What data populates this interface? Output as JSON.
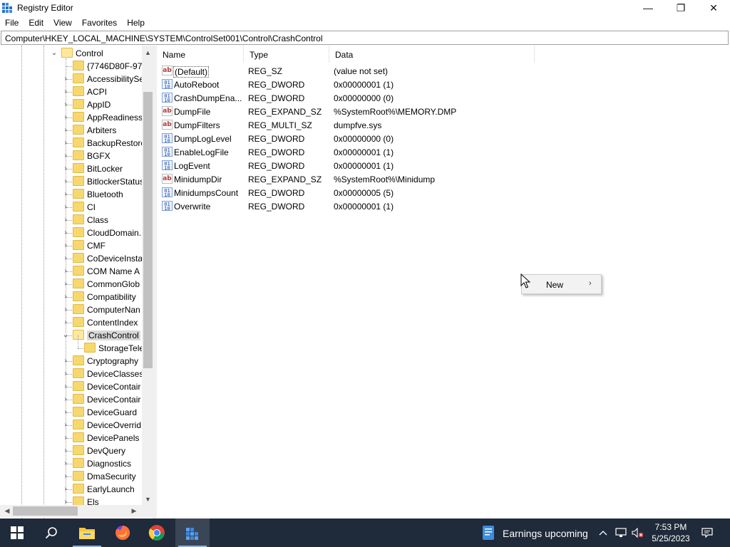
{
  "window": {
    "title": "Registry Editor",
    "minimize_glyph": "—",
    "maximize_glyph": "❐",
    "close_glyph": "✕"
  },
  "menu": [
    "File",
    "Edit",
    "View",
    "Favorites",
    "Help"
  ],
  "address": "Computer\\HKEY_LOCAL_MACHINE\\SYSTEM\\ControlSet001\\Control\\CrashControl",
  "tree": {
    "parent": "Control",
    "items": [
      {
        "label": "{7746D80F-97E",
        "expandable": false
      },
      {
        "label": "AccessibilitySe",
        "expandable": true
      },
      {
        "label": "ACPI",
        "expandable": true
      },
      {
        "label": "AppID",
        "expandable": true
      },
      {
        "label": "AppReadiness",
        "expandable": true
      },
      {
        "label": "Arbiters",
        "expandable": true
      },
      {
        "label": "BackupRestore",
        "expandable": true
      },
      {
        "label": "BGFX",
        "expandable": true
      },
      {
        "label": "BitLocker",
        "expandable": true
      },
      {
        "label": "BitlockerStatus",
        "expandable": true
      },
      {
        "label": "Bluetooth",
        "expandable": true
      },
      {
        "label": "CI",
        "expandable": true
      },
      {
        "label": "Class",
        "expandable": true
      },
      {
        "label": "CloudDomain.",
        "expandable": true
      },
      {
        "label": "CMF",
        "expandable": true
      },
      {
        "label": "CoDeviceInsta",
        "expandable": true
      },
      {
        "label": "COM Name A",
        "expandable": true
      },
      {
        "label": "CommonGlob",
        "expandable": true
      },
      {
        "label": "Compatibility",
        "expandable": true
      },
      {
        "label": "ComputerNan",
        "expandable": true
      },
      {
        "label": "ContentIndex",
        "expandable": true
      },
      {
        "label": "CrashControl",
        "expandable": true,
        "expanded": true,
        "selected": true
      },
      {
        "label": "StorageTele",
        "expandable": false,
        "child": true
      },
      {
        "label": "Cryptography",
        "expandable": true
      },
      {
        "label": "DeviceClasses",
        "expandable": true
      },
      {
        "label": "DeviceContair",
        "expandable": true
      },
      {
        "label": "DeviceContair",
        "expandable": true
      },
      {
        "label": "DeviceGuard",
        "expandable": true
      },
      {
        "label": "DeviceOverrid",
        "expandable": true
      },
      {
        "label": "DevicePanels",
        "expandable": true
      },
      {
        "label": "DevQuery",
        "expandable": true
      },
      {
        "label": "Diagnostics",
        "expandable": true
      },
      {
        "label": "DmaSecurity",
        "expandable": true
      },
      {
        "label": "EarlyLaunch",
        "expandable": true
      },
      {
        "label": "Els",
        "expandable": true
      }
    ]
  },
  "columns": {
    "name": "Name",
    "type": "Type",
    "data": "Data"
  },
  "values": [
    {
      "name": "(Default)",
      "type": "REG_SZ",
      "data": "(value not set)",
      "icon": "string-value-icon"
    },
    {
      "name": "AutoReboot",
      "type": "REG_DWORD",
      "data": "0x00000001 (1)",
      "icon": "binary-value-icon"
    },
    {
      "name": "CrashDumpEna...",
      "type": "REG_DWORD",
      "data": "0x00000000 (0)",
      "icon": "binary-value-icon"
    },
    {
      "name": "DumpFile",
      "type": "REG_EXPAND_SZ",
      "data": "%SystemRoot%\\MEMORY.DMP",
      "icon": "string-value-icon"
    },
    {
      "name": "DumpFilters",
      "type": "REG_MULTI_SZ",
      "data": "dumpfve.sys",
      "icon": "string-value-icon"
    },
    {
      "name": "DumpLogLevel",
      "type": "REG_DWORD",
      "data": "0x00000000 (0)",
      "icon": "binary-value-icon"
    },
    {
      "name": "EnableLogFile",
      "type": "REG_DWORD",
      "data": "0x00000001 (1)",
      "icon": "binary-value-icon"
    },
    {
      "name": "LogEvent",
      "type": "REG_DWORD",
      "data": "0x00000001 (1)",
      "icon": "binary-value-icon"
    },
    {
      "name": "MinidumpDir",
      "type": "REG_EXPAND_SZ",
      "data": "%SystemRoot%\\Minidump",
      "icon": "string-value-icon"
    },
    {
      "name": "MinidumpsCount",
      "type": "REG_DWORD",
      "data": "0x00000005 (5)",
      "icon": "binary-value-icon"
    },
    {
      "name": "Overwrite",
      "type": "REG_DWORD",
      "data": "0x00000001 (1)",
      "icon": "binary-value-icon"
    }
  ],
  "context_menu": {
    "item": "New",
    "arrow": "›"
  },
  "taskbar": {
    "apps": [
      "start-icon",
      "search-icon",
      "file-explorer-icon",
      "firefox-icon",
      "chrome-icon",
      "registry-editor-icon"
    ],
    "weather_text": "Earnings upcoming",
    "time": "7:53 PM",
    "date": "5/25/2023"
  },
  "colors": {
    "taskbar": "#1f2a3a",
    "folder": "#f6d86f",
    "selection": "#d9d9d9"
  }
}
